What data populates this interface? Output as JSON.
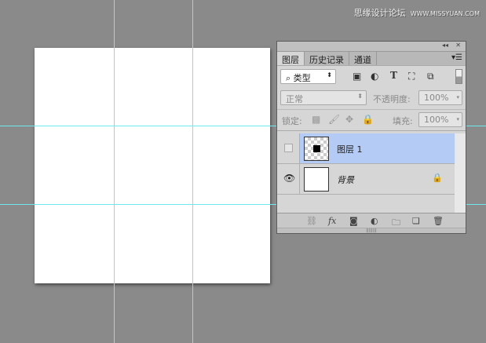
{
  "watermark": {
    "cn": "思缘设计论坛",
    "url": "WWW.MISSYUAN.COM"
  },
  "panel": {
    "collapse_icon": "double-chevron-left",
    "close_icon": "close",
    "tabs": [
      "图层",
      "历史记录",
      "通道"
    ],
    "filter": {
      "label": "类型",
      "icons": [
        "image-filter-icon",
        "adjustment-filter-icon",
        "text-filter-icon",
        "shape-filter-icon",
        "smart-object-filter-icon"
      ]
    },
    "blend_mode": "正常",
    "opacity_label": "不透明度:",
    "opacity": "100%",
    "lock_label": "锁定:",
    "fill_label": "填充:",
    "fill": "100%",
    "layers": [
      {
        "name": "图层 1",
        "selected": true,
        "visible": false
      },
      {
        "name": "背景",
        "selected": false,
        "visible": true,
        "locked": true
      }
    ],
    "colors": {
      "selected": "#b4cbf5",
      "guide": "#6ee8ee"
    }
  }
}
